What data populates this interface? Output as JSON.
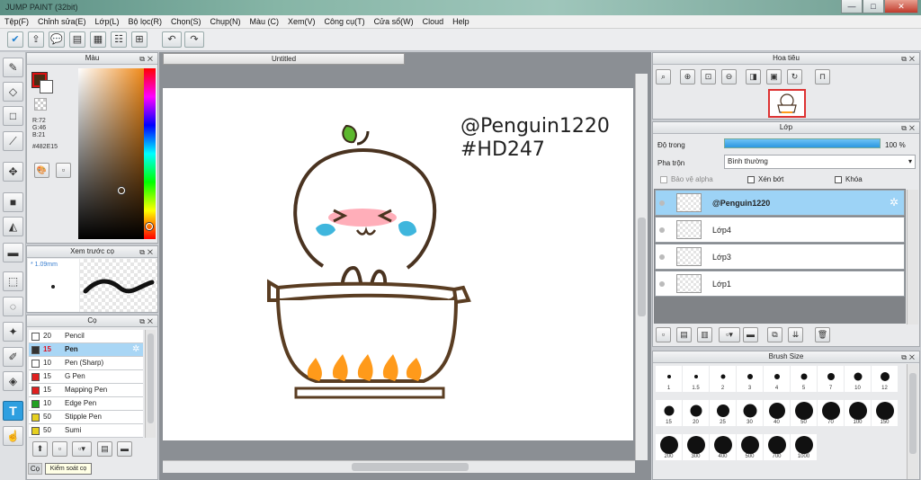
{
  "app": {
    "title": "JUMP PAINT (32bit)"
  },
  "window_controls": {
    "minimize": "—",
    "maximize": "□",
    "close": "✕"
  },
  "menu": [
    "Tệp(F)",
    "Chỉnh sửa(E)",
    "Lớp(L)",
    "Bộ lọc(R)",
    "Chọn(S)",
    "Chụp(N)",
    "Màu (C)",
    "Xem(V)",
    "Công cụ(T)",
    "Cửa sổ(W)",
    "Cloud",
    "Help"
  ],
  "toolbar_icons": [
    "check-icon",
    "export-icon",
    "speech-bubble-icon",
    "panel-icon",
    "document-icon",
    "layers-icon",
    "grid-icon",
    "undo-icon",
    "redo-icon"
  ],
  "color_panel": {
    "title": "Màu",
    "r": "R:72",
    "g": "G:46",
    "b": "B:21",
    "hex": "#482E15",
    "main_color": "#482e15"
  },
  "preview_panel": {
    "title": "Xem trước cọ",
    "size": "* 1.09mm"
  },
  "brush_panel": {
    "title": "Cọ",
    "items": [
      {
        "size": "20",
        "name": "Pencil",
        "color": "#ffffff"
      },
      {
        "size": "15",
        "name": "Pen",
        "color": "#333333",
        "selected": true
      },
      {
        "size": "10",
        "name": "Pen (Sharp)",
        "color": "#ffffff"
      },
      {
        "size": "15",
        "name": "G Pen",
        "color": "#e02020"
      },
      {
        "size": "15",
        "name": "Mapping Pen",
        "color": "#e02020"
      },
      {
        "size": "10",
        "name": "Edge Pen",
        "color": "#22a022"
      },
      {
        "size": "50",
        "name": "Stipple Pen",
        "color": "#e6d020"
      },
      {
        "size": "50",
        "name": "Sumi",
        "color": "#e6d020"
      }
    ],
    "tooltip": "Kiểm soát cọ",
    "bottom_tab": "Cọ"
  },
  "document": {
    "tab": "Untitled",
    "text_line1": "@Penguin1220",
    "text_line2": "#HD247"
  },
  "navigator": {
    "title": "Hoa tiêu"
  },
  "layer_panel": {
    "title": "Lớp",
    "opacity_label": "Độ trong",
    "opacity_value": "100 %",
    "opacity_fraction": 1.0,
    "blend_label": "Pha trộn",
    "blend_value": "Bình thường",
    "protect_alpha": "Bảo vệ alpha",
    "clipping": "Xén bớt",
    "lock": "Khóa",
    "layers": [
      {
        "name": "@Penguin1220",
        "selected": true
      },
      {
        "name": "Lớp4"
      },
      {
        "name": "Lớp3"
      },
      {
        "name": "Lớp1"
      }
    ]
  },
  "brush_size_panel": {
    "title": "Brush Size",
    "sizes": [
      "1",
      "1.5",
      "2",
      "3",
      "4",
      "5",
      "7",
      "10",
      "12",
      "15",
      "20",
      "25",
      "30",
      "40",
      "50",
      "70",
      "100",
      "150",
      "200",
      "300",
      "400",
      "500",
      "700",
      "1000"
    ]
  }
}
